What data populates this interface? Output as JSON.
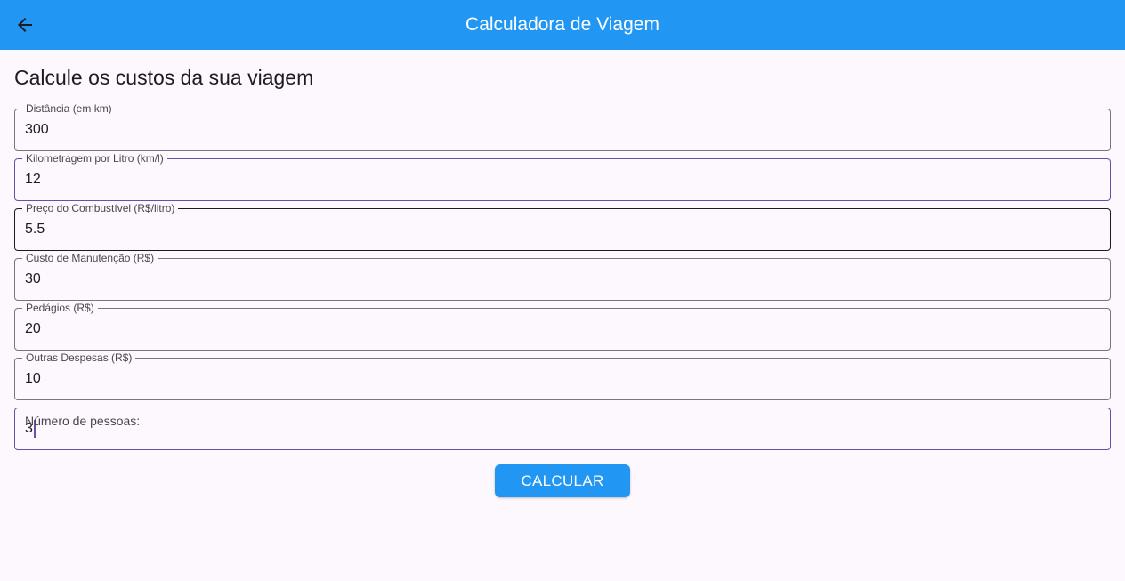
{
  "appbar": {
    "title": "Calculadora de Viagem",
    "back_icon": "arrow-back-icon",
    "background": "#2196f3"
  },
  "page": {
    "heading": "Calcule os custos da sua viagem"
  },
  "fields": [
    {
      "label": "Distância (em km)",
      "value": "300"
    },
    {
      "label": "Kilometragem por Litro (km/l)",
      "value": "12"
    },
    {
      "label": "Preço do Combustível (R$/litro)",
      "value": "5.5"
    },
    {
      "label": "Custo de Manutenção (R$)",
      "value": "30"
    },
    {
      "label": "Pedágios (R$)",
      "value": "20"
    },
    {
      "label": "Outras Despesas (R$)",
      "value": "10"
    },
    {
      "label": "Número de pessoas:",
      "value": "3"
    }
  ],
  "actions": {
    "calculate_label": "CALCULAR"
  }
}
